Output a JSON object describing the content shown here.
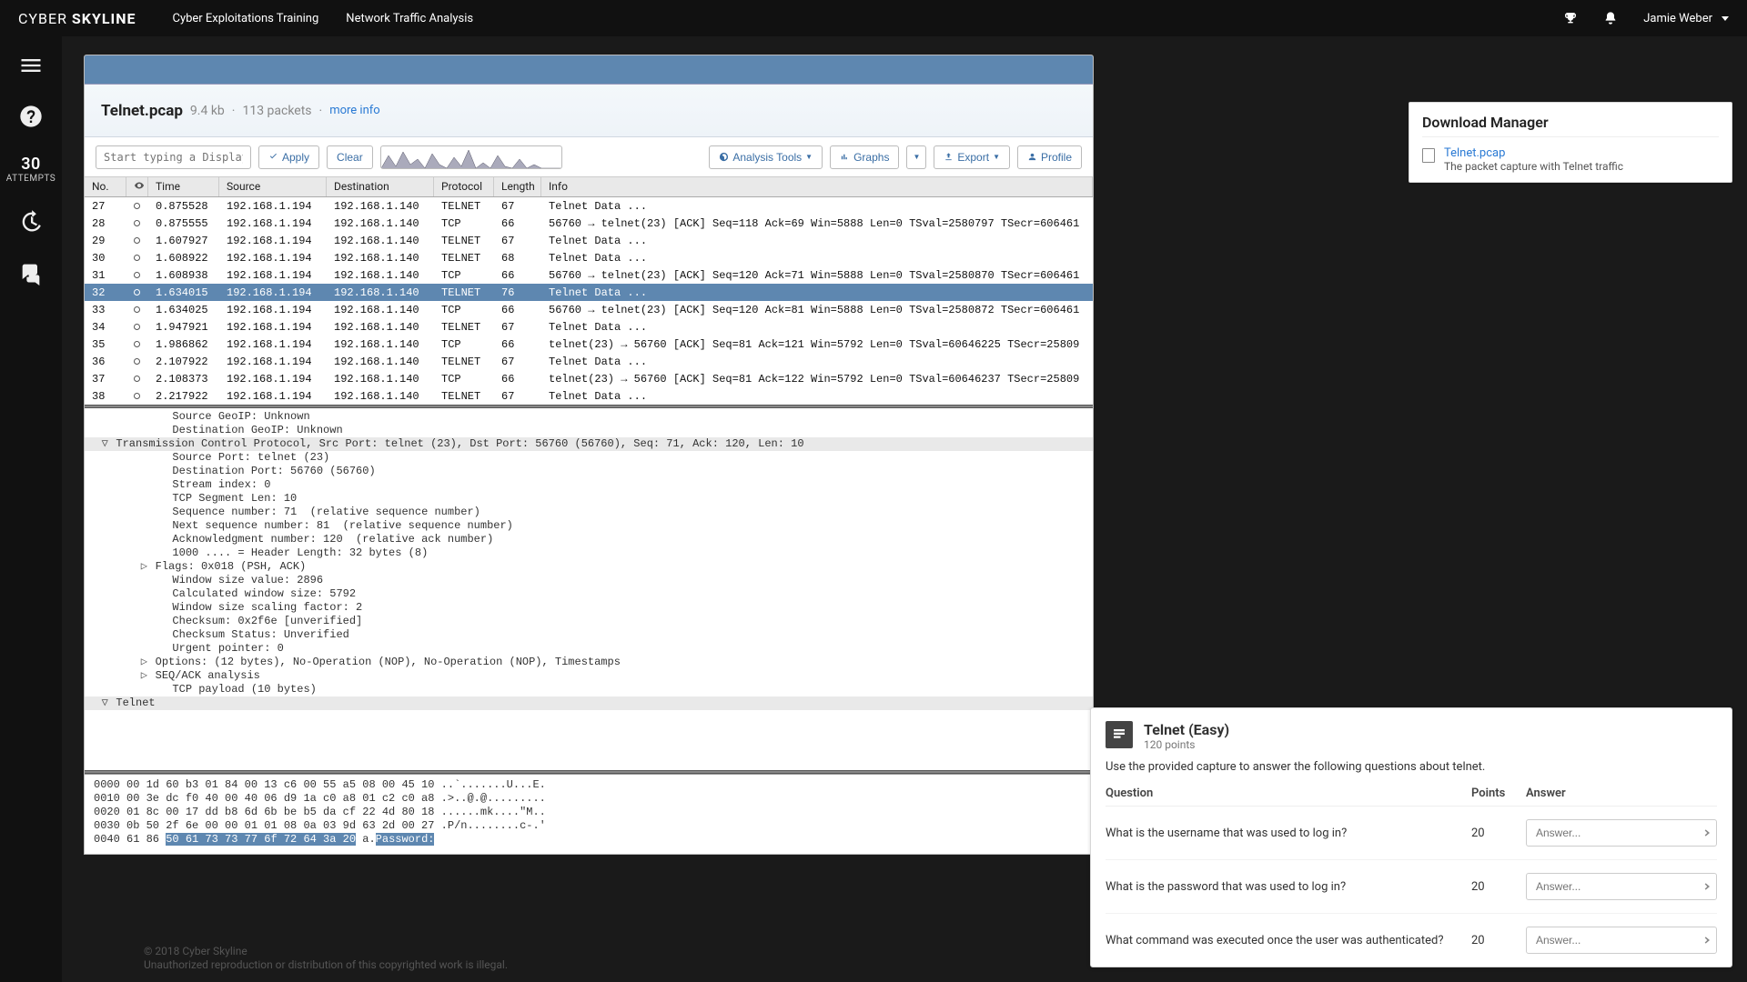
{
  "topbar": {
    "brand_a": "CYBER ",
    "brand_b": "SKYLINE",
    "links": [
      "Cyber Exploitations Training",
      "Network Traffic Analysis"
    ],
    "user": "Jamie Weber"
  },
  "rail": {
    "attempts_num": "30",
    "attempts_label": "ATTEMPTS"
  },
  "ws": {
    "filename": "Telnet.pcap",
    "size": "9.4 kb",
    "packets": "113 packets",
    "more": "more info",
    "filter_ph": "Start typing a Display Filter",
    "apply": "Apply",
    "clear": "Clear",
    "tools": "Analysis Tools",
    "graphs": "Graphs",
    "export": "Export",
    "profile": "Profile",
    "head": {
      "no": "No.",
      "time": "Time",
      "src": "Source",
      "dst": "Destination",
      "proto": "Protocol",
      "len": "Length",
      "info": "Info"
    },
    "rows": [
      {
        "no": "27",
        "time": "0.875528",
        "src": "192.168.1.194",
        "dst": "192.168.1.140",
        "proto": "TELNET",
        "len": "67",
        "info": "Telnet Data ..."
      },
      {
        "no": "28",
        "time": "0.875555",
        "src": "192.168.1.194",
        "dst": "192.168.1.140",
        "proto": "TCP",
        "len": "66",
        "info": "56760 → telnet(23) [ACK] Seq=118 Ack=69 Win=5888 Len=0 TSval=2580797 TSecr=606461"
      },
      {
        "no": "29",
        "time": "1.607927",
        "src": "192.168.1.194",
        "dst": "192.168.1.140",
        "proto": "TELNET",
        "len": "67",
        "info": "Telnet Data ..."
      },
      {
        "no": "30",
        "time": "1.608922",
        "src": "192.168.1.194",
        "dst": "192.168.1.140",
        "proto": "TELNET",
        "len": "68",
        "info": "Telnet Data ..."
      },
      {
        "no": "31",
        "time": "1.608938",
        "src": "192.168.1.194",
        "dst": "192.168.1.140",
        "proto": "TCP",
        "len": "66",
        "info": "56760 → telnet(23) [ACK] Seq=120 Ack=71 Win=5888 Len=0 TSval=2580870 TSecr=606461"
      },
      {
        "no": "32",
        "time": "1.634015",
        "src": "192.168.1.194",
        "dst": "192.168.1.140",
        "proto": "TELNET",
        "len": "76",
        "info": "Telnet Data ...",
        "sel": true
      },
      {
        "no": "33",
        "time": "1.634025",
        "src": "192.168.1.194",
        "dst": "192.168.1.140",
        "proto": "TCP",
        "len": "66",
        "info": "56760 → telnet(23) [ACK] Seq=120 Ack=81 Win=5888 Len=0 TSval=2580872 TSecr=606461"
      },
      {
        "no": "34",
        "time": "1.947921",
        "src": "192.168.1.194",
        "dst": "192.168.1.140",
        "proto": "TELNET",
        "len": "67",
        "info": "Telnet Data ..."
      },
      {
        "no": "35",
        "time": "1.986862",
        "src": "192.168.1.194",
        "dst": "192.168.1.140",
        "proto": "TCP",
        "len": "66",
        "info": "telnet(23) → 56760 [ACK] Seq=81 Ack=121 Win=5792 Len=0 TSval=60646225 TSecr=25809"
      },
      {
        "no": "36",
        "time": "2.107922",
        "src": "192.168.1.194",
        "dst": "192.168.1.140",
        "proto": "TELNET",
        "len": "67",
        "info": "Telnet Data ..."
      },
      {
        "no": "37",
        "time": "2.108373",
        "src": "192.168.1.194",
        "dst": "192.168.1.140",
        "proto": "TCP",
        "len": "66",
        "info": "telnet(23) → 56760 [ACK] Seq=81 Ack=122 Win=5792 Len=0 TSval=60646237 TSecr=25809"
      },
      {
        "no": "38",
        "time": "2.217922",
        "src": "192.168.1.194",
        "dst": "192.168.1.140",
        "proto": "TELNET",
        "len": "67",
        "info": "Telnet Data ..."
      }
    ],
    "details": [
      {
        "ind": 4,
        "t": "Source GeoIP: Unknown"
      },
      {
        "ind": 4,
        "t": "Destination GeoIP: Unknown"
      },
      {
        "ind": 1,
        "tw": "▽",
        "hdr": true,
        "t": "Transmission Control Protocol, Src Port: telnet (23), Dst Port: 56760 (56760), Seq: 71, Ack: 120, Len: 10"
      },
      {
        "ind": 4,
        "t": "Source Port: telnet (23)"
      },
      {
        "ind": 4,
        "t": "Destination Port: 56760 (56760)"
      },
      {
        "ind": 4,
        "t": "Stream index: 0"
      },
      {
        "ind": 4,
        "t": "TCP Segment Len: 10"
      },
      {
        "ind": 4,
        "t": "Sequence number: 71  (relative sequence number)"
      },
      {
        "ind": 4,
        "t": "Next sequence number: 81  (relative sequence number)"
      },
      {
        "ind": 4,
        "t": "Acknowledgment number: 120  (relative ack number)"
      },
      {
        "ind": 4,
        "t": "1000 .... = Header Length: 32 bytes (8)"
      },
      {
        "ind": 3,
        "tw": "▷",
        "t": "Flags: 0x018 (PSH, ACK)"
      },
      {
        "ind": 4,
        "t": "Window size value: 2896"
      },
      {
        "ind": 4,
        "t": "Calculated window size: 5792"
      },
      {
        "ind": 4,
        "t": "Window size scaling factor: 2"
      },
      {
        "ind": 4,
        "t": "Checksum: 0x2f6e [unverified]"
      },
      {
        "ind": 4,
        "t": "Checksum Status: Unverified"
      },
      {
        "ind": 4,
        "t": "Urgent pointer: 0"
      },
      {
        "ind": 3,
        "tw": "▷",
        "t": "Options: (12 bytes), No-Operation (NOP), No-Operation (NOP), Timestamps"
      },
      {
        "ind": 3,
        "tw": "▷",
        "t": "SEQ/ACK analysis"
      },
      {
        "ind": 4,
        "t": "TCP payload (10 bytes)"
      },
      {
        "ind": 1,
        "tw": "▽",
        "hdr": true,
        "t": "Telnet"
      }
    ],
    "hex": [
      {
        "off": "0000",
        "b": "00 1d 60 b3 01 84 00 13 c6 00 55 a5 08 00 45 10",
        "a": "..`.......U...E."
      },
      {
        "off": "0010",
        "b": "00 3e dc f0 40 00 40 06 d9 1a c0 a8 01 c2 c0 a8",
        "a": ".>..@.@........."
      },
      {
        "off": "0020",
        "b": "01 8c 00 17 dd b8 6d 6b be b5 da cf 22 4d 80 18",
        "a": "......mk....\"M.."
      },
      {
        "off": "0030",
        "b": "0b 50 2f 6e 00 00 01 01 08 0a 03 9d 63 2d 00 27",
        "a": ".P/n........c-.'"
      },
      {
        "off": "0040",
        "b": "61 86 ",
        "b2": "50 61 73 73 77 6f 72 64 3a 20",
        "a": "a.",
        "a2": "Password: "
      }
    ]
  },
  "footer": {
    "l1": "© 2018 Cyber Skyline",
    "l2": "Unauthorized reproduction or distribution of this copyrighted work is illegal."
  },
  "dlmgr": {
    "title": "Download Manager",
    "file": "Telnet.pcap",
    "desc": "The packet capture with Telnet traffic"
  },
  "chal": {
    "title": "Telnet (Easy)",
    "pts": "120 points",
    "desc": "Use the provided capture to answer the following questions about telnet.",
    "head_q": "Question",
    "head_p": "Points",
    "head_a": "Answer",
    "ans_ph": "Answer...",
    "qs": [
      {
        "q": "What is the username that was used to log in?",
        "p": "20"
      },
      {
        "q": "What is the password that was used to log in?",
        "p": "20"
      },
      {
        "q": "What command was executed once the user was authenticated?",
        "p": "20"
      }
    ]
  }
}
